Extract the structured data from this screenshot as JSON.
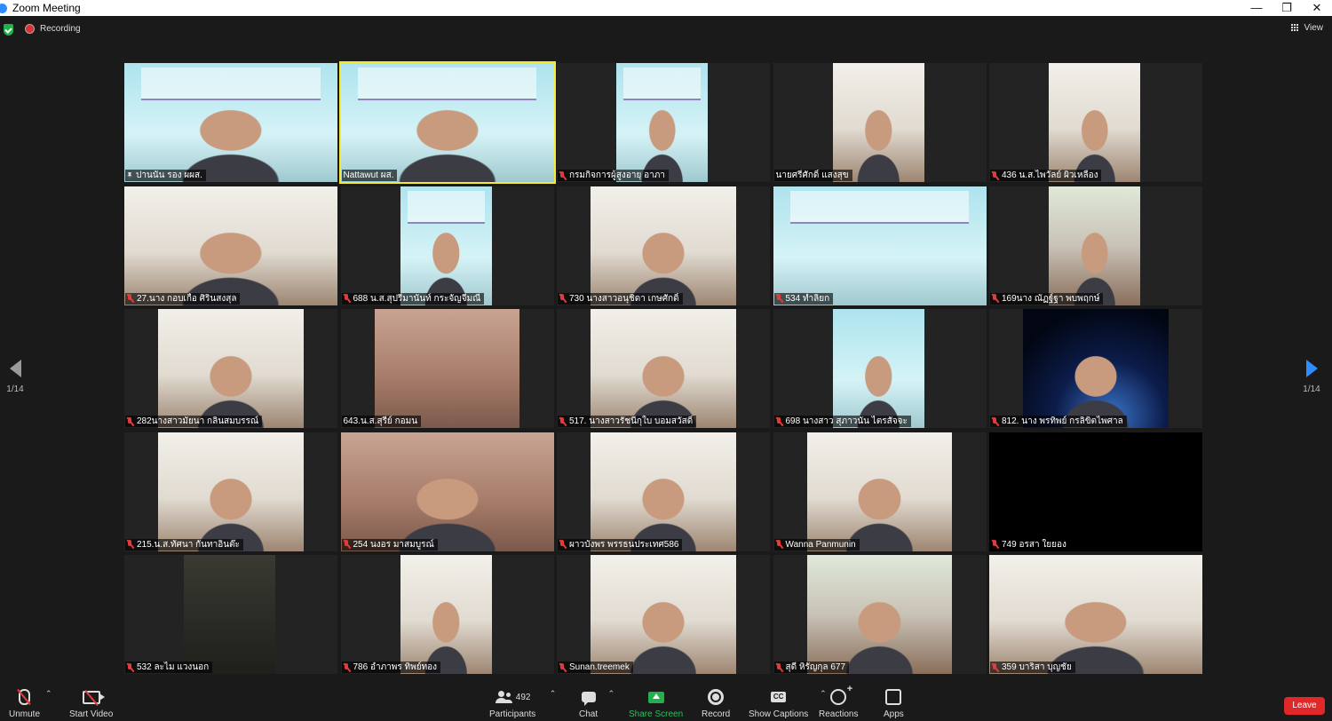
{
  "window": {
    "title": "Zoom Meeting",
    "controls": [
      "—",
      "❐",
      "✕"
    ]
  },
  "top": {
    "recording_label": "Recording",
    "view_label": "View"
  },
  "pager": {
    "left_page": "1/14",
    "right_page": "1/14"
  },
  "tiles": [
    {
      "name": "ปานนัน  รอง ผผส.",
      "indicator": "pin",
      "active": false
    },
    {
      "name": "Nattawut ผส.",
      "indicator": "none",
      "active": true
    },
    {
      "name": "กรมกิจการผู้สูงอายุ อาภา",
      "indicator": "mute",
      "active": false
    },
    {
      "name": "นายศรีศักดิ์  แสงสุข",
      "indicator": "none",
      "active": false
    },
    {
      "name": "436 น.ส.ไพวัลย์ ผิวเหลือง",
      "indicator": "mute",
      "active": false
    },
    {
      "name": "27.นาง กอบเกื้อ ศิรินสงสุล",
      "indicator": "mute",
      "active": false
    },
    {
      "name": "688 น.ส.สุปรีมานันท์ กระจัญจีมณี",
      "indicator": "mute",
      "active": false
    },
    {
      "name": "730  นางสาวอนุชิดา เกษศักดิ์",
      "indicator": "mute",
      "active": false
    },
    {
      "name": "534 ทำลิยก",
      "indicator": "mute",
      "active": false
    },
    {
      "name": "169นาง ณัฏฐ์ฐา พบพฤกษ์",
      "indicator": "mute",
      "active": false
    },
    {
      "name": "282นางสาวมัยนา กลิ่นสมบรรณ์",
      "indicator": "mute",
      "active": false
    },
    {
      "name": "643.น.ส.สุรีย์  กอมน",
      "indicator": "none",
      "active": false
    },
    {
      "name": "517. นางสาวรัชนีกุใบ บอมสวัสดิ์",
      "indicator": "mute",
      "active": false
    },
    {
      "name": "698 นางสาว สุภาวนัน ไตรสัจจะ",
      "indicator": "mute",
      "active": false
    },
    {
      "name": "812. นาง พรทิพย์ กรลิขิตไพศาล",
      "indicator": "mute",
      "active": false
    },
    {
      "name": "215.น.ส.ทัศนา กันทาอินต๊ะ",
      "indicator": "mute",
      "active": false
    },
    {
      "name": "254 นงอร มาสมบูรณ์",
      "indicator": "mute",
      "active": false
    },
    {
      "name": "ผาวบังพร พรรธนประเทศ586",
      "indicator": "mute",
      "active": false
    },
    {
      "name": "Wanna Panmunin",
      "indicator": "mute",
      "active": false
    },
    {
      "name": "749 อรสา ใยยอง",
      "indicator": "mute",
      "active": false
    },
    {
      "name": "532  ละไม  แวงนอก",
      "indicator": "mute",
      "active": false
    },
    {
      "name": "786 อำภาพร ทิพย์ทอง",
      "indicator": "mute",
      "active": false
    },
    {
      "name": "Sunan.treemek",
      "indicator": "mute",
      "active": false
    },
    {
      "name": "สุดี หิรัญกุล 677",
      "indicator": "mute",
      "active": false
    },
    {
      "name": "359 บาริสา    บุญชัย",
      "indicator": "mute",
      "active": false
    }
  ],
  "toolbar": {
    "unmute": "Unmute",
    "start_video": "Start Video",
    "participants": "Participants",
    "participants_count": "492",
    "chat": "Chat",
    "share_screen": "Share Screen",
    "record": "Record",
    "show_captions": "Show Captions",
    "captions_icon_text": "CC",
    "reactions": "Reactions",
    "apps": "Apps",
    "leave": "Leave"
  },
  "colors": {
    "active_speaker": "#f5e934",
    "share_green": "#23b14d",
    "leave_red": "#e02828",
    "mute_red": "#e23b3b",
    "accent_blue": "#2d8cff"
  }
}
